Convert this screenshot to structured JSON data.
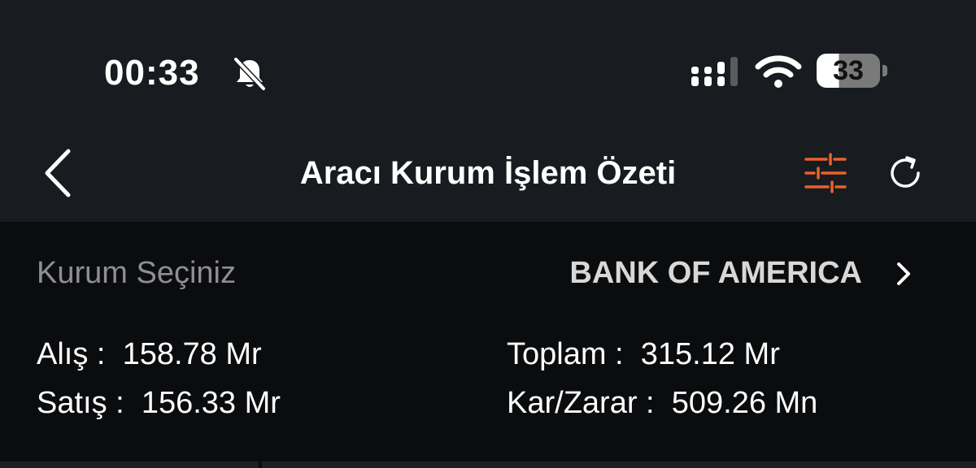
{
  "status_bar": {
    "time": "00:33",
    "battery_level": "33"
  },
  "header": {
    "title": "Aracı Kurum İşlem Özeti"
  },
  "selector": {
    "label": "Kurum Seçiniz",
    "value": "BANK OF AMERICA"
  },
  "summary": {
    "alis_label": "Alış :",
    "alis_value": "158.78 Mr",
    "satis_label": "Satış :",
    "satis_value": "156.33 Mr",
    "toplam_label": "Toplam :",
    "toplam_value": "315.12 Mr",
    "karzarar_label": "Kar/Zarar :",
    "karzarar_value": "509.26 Mn"
  },
  "colors": {
    "accent": "#e8622a",
    "header_bg": "#181b20",
    "content_bg": "#0b0c0e",
    "muted_text": "#8e8e93"
  },
  "icons": {
    "back": "chevron-left-icon",
    "filter": "sliders-icon",
    "refresh": "refresh-icon",
    "select": "chevron-right-icon",
    "silent": "bell-slash-icon"
  }
}
